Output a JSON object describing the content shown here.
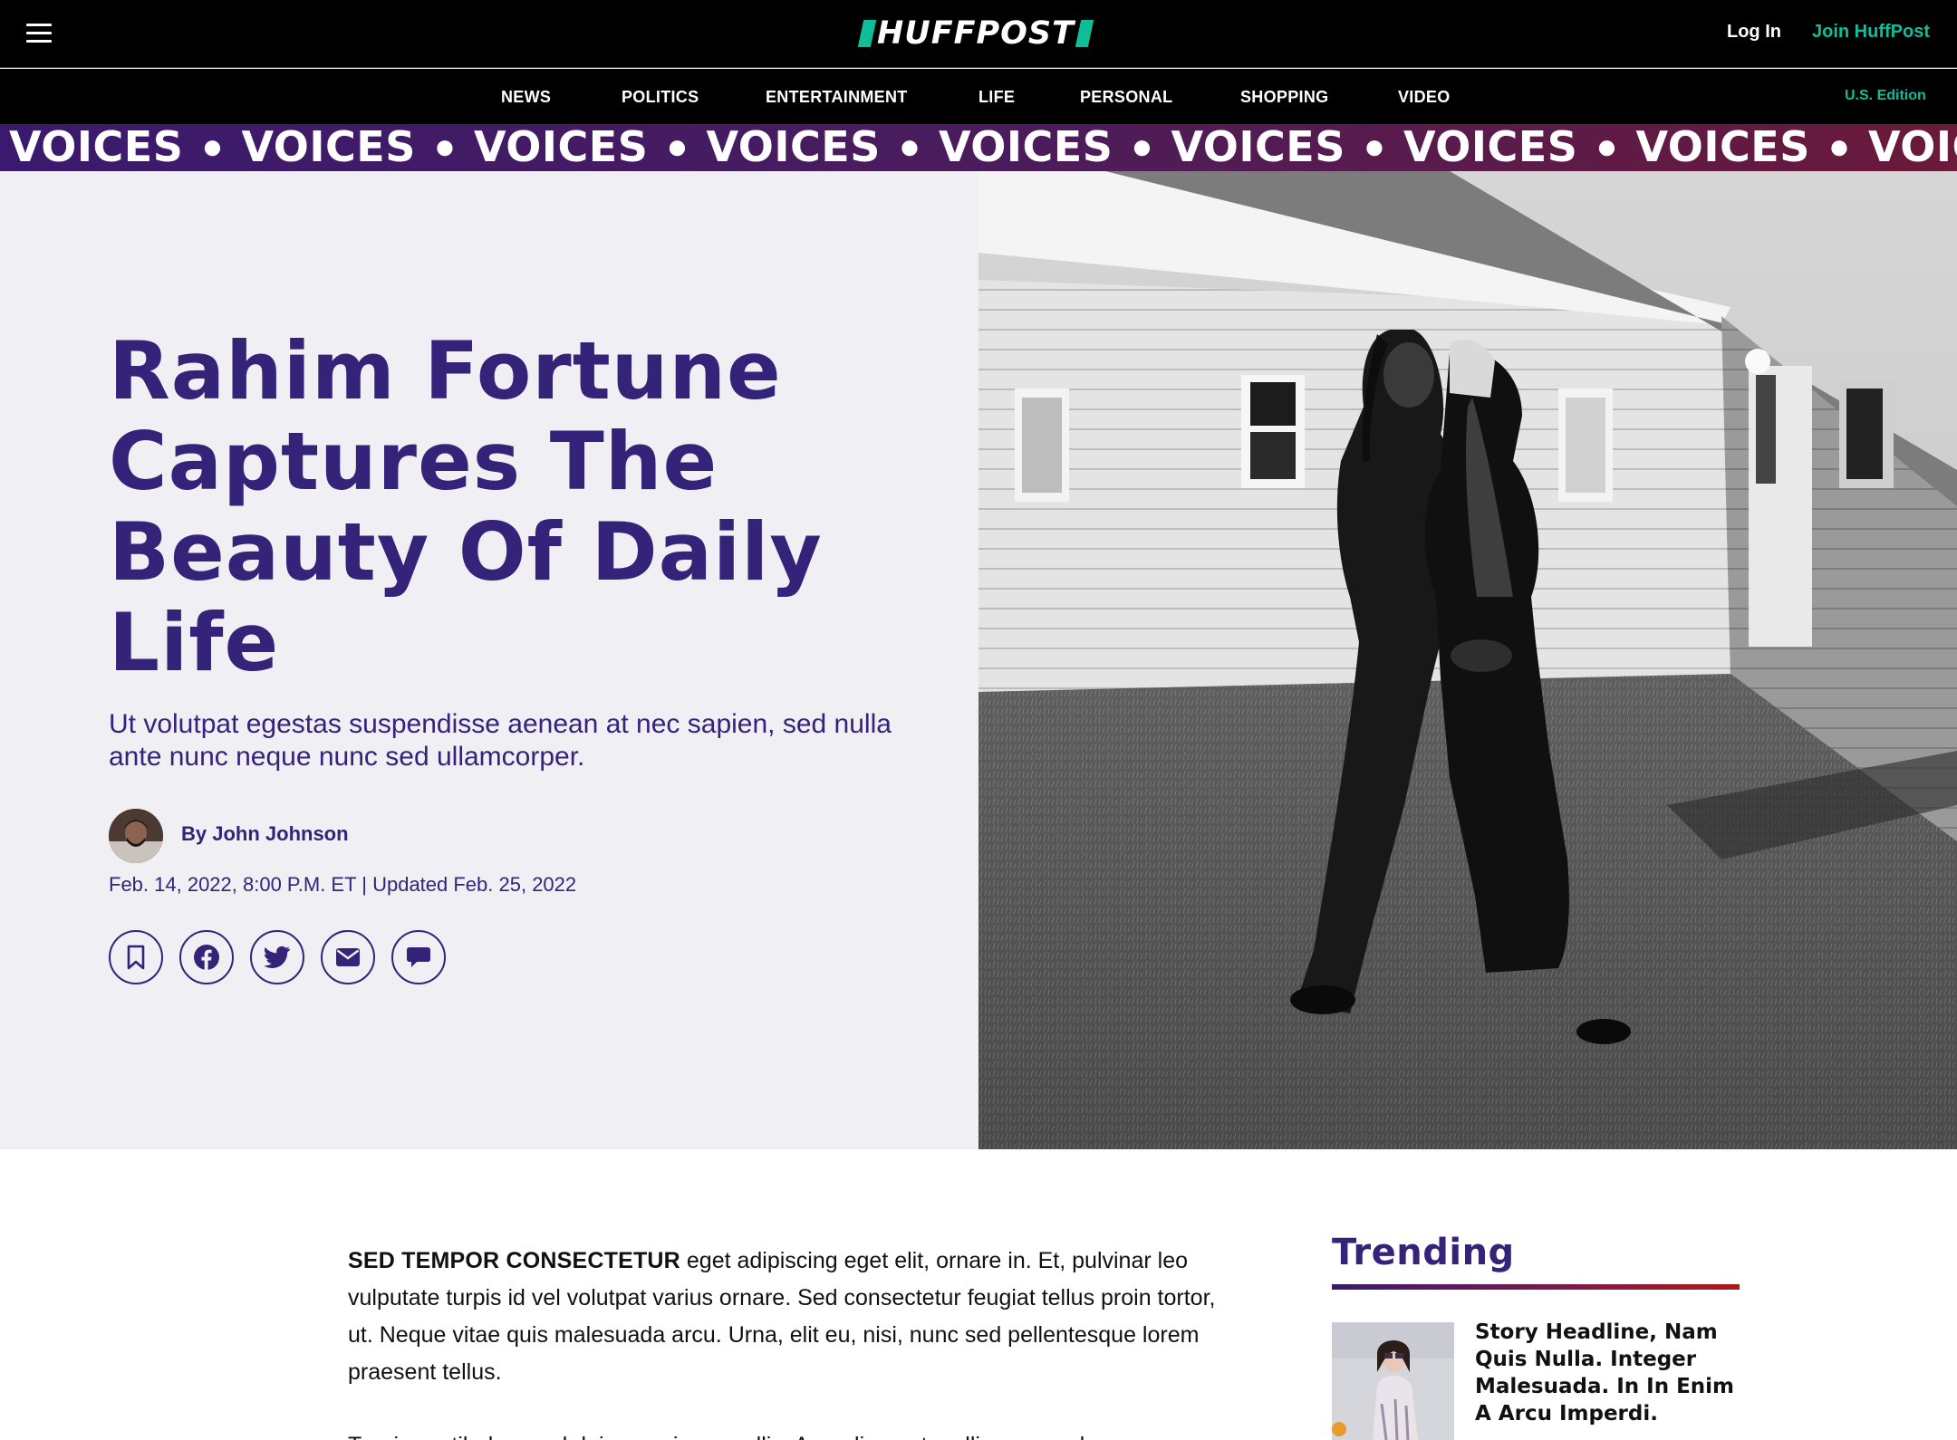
{
  "header": {
    "logo_text": "HUFFPOST",
    "login_label": "Log In",
    "join_label": "Join HuffPost",
    "accent_color": "#0dbe98"
  },
  "nav": {
    "items": [
      "NEWS",
      "POLITICS",
      "ENTERTAINMENT",
      "LIFE",
      "PERSONAL",
      "SHOPPING",
      "VIDEO"
    ],
    "edition_label": "U.S. Edition"
  },
  "ribbon": {
    "word": "VOICES"
  },
  "hero": {
    "headline": "Rahim Fortune Captures The Beauty Of Daily Life",
    "subhead": "Ut volutpat egestas suspendisse aenean at nec sapien, sed nulla ante nunc neque nunc sed ullamcorper.",
    "byline": "By John Johnson",
    "dateline": "Feb. 14, 2022, 8:00 P.M. ET | Updated Feb. 25, 2022",
    "headline_color": "#35237a",
    "share_icons": [
      "bookmark-icon",
      "facebook-icon",
      "twitter-icon",
      "email-icon",
      "comment-icon"
    ]
  },
  "article": {
    "lead_in": "SED TEMPOR CONSECTETUR",
    "paragraph1_rest": " eget adipiscing eget elit, ornare in. Et, pulvinar leo vulputate turpis id vel volutpat varius ornare. Sed consectetur feugiat tellus proin tortor, ut. Neque vitae quis malesuada arcu. Urna, elit eu, nisi, nunc sed pellentesque lorem praesent tellus.",
    "paragraph2": "Turpis vestibulum sed duis mauris convallis. Arcu diam, et mollis commodo"
  },
  "trending": {
    "title": "Trending",
    "story_headline": "Story Headline, Nam Quis Nulla. Integer Malesuada. In In Enim A Arcu Imperdi."
  }
}
